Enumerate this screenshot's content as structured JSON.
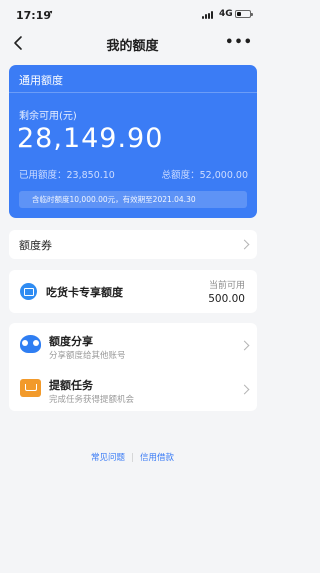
{
  "status_bar": {
    "time": "17:19",
    "network": "4G"
  },
  "nav": {
    "title": "我的额度",
    "more": "•••"
  },
  "quota_card": {
    "title": "通用额度",
    "remaining_label": "剩余可用(元)",
    "remaining_amount": "28,149.90",
    "used_text": "已用额度：23,850.10",
    "total_text": "总额度：52,000.00",
    "notice": "含临时额度10,000.00元，有效期至2021.04.30"
  },
  "coupon": {
    "label": "额度券"
  },
  "foodie_card": {
    "label": "吃货卡专享额度",
    "sub_label": "当前可用",
    "value": "500.00"
  },
  "services": [
    {
      "title": "额度分享",
      "subtitle": "分享额度给其他账号"
    },
    {
      "title": "提额任务",
      "subtitle": "完成任务获得提额机会"
    }
  ],
  "footer": {
    "faq": "常见问题",
    "divider": "|",
    "loan": "信用借款"
  },
  "colors": {
    "accent": "#3b7cf5",
    "orange": "#f29a2b",
    "background": "#f4f5f7"
  }
}
